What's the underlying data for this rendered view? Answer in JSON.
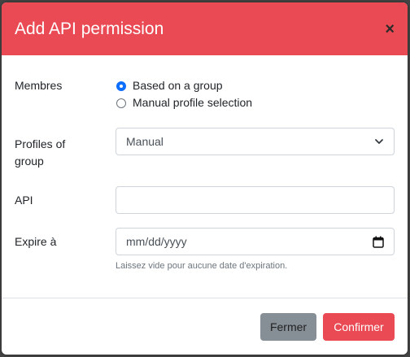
{
  "modal": {
    "title": "Add API permission",
    "close_glyph": "×"
  },
  "form": {
    "members_label": "Membres",
    "radio_options": [
      {
        "label": "Based on a group",
        "checked": true
      },
      {
        "label": "Manual profile selection",
        "checked": false
      }
    ],
    "profiles_label_line1": "Profiles of",
    "profiles_label_line2": "group",
    "profiles_selected": "Manual",
    "api_label": "API",
    "api_value": "",
    "expire_label": "Expire à",
    "expire_placeholder": "mm/dd/yyyy",
    "expire_help": "Laissez vide pour aucune date d'expiration."
  },
  "footer": {
    "cancel_label": "Fermer",
    "confirm_label": "Confirmer"
  },
  "colors": {
    "header": "#e94a53",
    "primary_button": "#e94a53",
    "secondary_button": "#868e96",
    "radio_checked": "#0d6efd"
  },
  "icons": {
    "close": "close-icon",
    "dropdown": "chevron-down-icon",
    "calendar": "calendar-icon"
  }
}
